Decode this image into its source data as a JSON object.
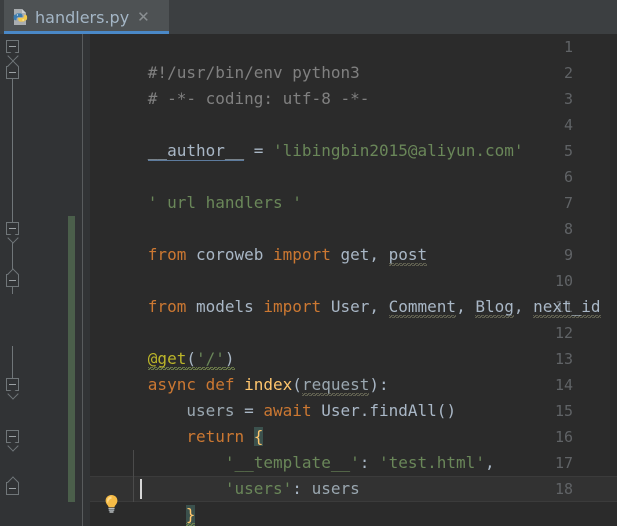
{
  "window": {
    "theme": "darcula",
    "background": "#2b2b2b"
  },
  "tabbar": {
    "tabs": [
      {
        "label": "handlers.py",
        "icon": "python-file-icon",
        "close_label": "✕",
        "active": true
      }
    ]
  },
  "editor": {
    "language": "Python",
    "caret": {
      "line": 18,
      "column": 10
    },
    "gutter": {
      "line_numbers": [
        "1",
        "2",
        "3",
        "4",
        "5",
        "6",
        "7",
        "8",
        "9",
        "10",
        "11",
        "12",
        "13",
        "14",
        "15",
        "16",
        "17",
        "18"
      ],
      "vcs_change_bar": {
        "from_line": 8,
        "to_line": 18,
        "color": "#4b5f4b"
      },
      "fold_markers": [
        {
          "line": 1,
          "type": "region-start"
        },
        {
          "line": 2,
          "type": "region-end"
        },
        {
          "line": 8,
          "type": "region-start"
        },
        {
          "line": 10,
          "type": "region-end"
        },
        {
          "line": 13,
          "type": "region-start"
        },
        {
          "line": 15,
          "type": "region-start"
        },
        {
          "line": 18,
          "type": "region-end"
        }
      ],
      "intention_bulb": {
        "line": 17,
        "icon": "lightbulb-icon"
      }
    },
    "lines": [
      {
        "n": 1,
        "text": "#!/usr/bin/env python3"
      },
      {
        "n": 2,
        "text": "# -*- coding: utf-8 -*-"
      },
      {
        "n": 3,
        "text": ""
      },
      {
        "n": 4,
        "text": "    __author__ = 'libingbin2015@aliyun.com'"
      },
      {
        "n": 5,
        "text": ""
      },
      {
        "n": 6,
        "text": "  ' url handlers '"
      },
      {
        "n": 7,
        "text": ""
      },
      {
        "n": 8,
        "text": "from coroweb import get, post"
      },
      {
        "n": 9,
        "text": ""
      },
      {
        "n": 10,
        "text": "from models import User, Comment, Blog, next_id"
      },
      {
        "n": 11,
        "text": ""
      },
      {
        "n": 12,
        "text": "  @get('/')"
      },
      {
        "n": 13,
        "text": "async def index(request):"
      },
      {
        "n": 14,
        "text": "    users = await User.findAll()"
      },
      {
        "n": 15,
        "text": "    return {"
      },
      {
        "n": 16,
        "text": "        '__template__': 'test.html',"
      },
      {
        "n": 17,
        "text": "        'users': users"
      },
      {
        "n": 18,
        "text": "    }"
      }
    ],
    "tokens": {
      "line1": {
        "comment": "#!/usr/bin/env python3"
      },
      "line2": {
        "comment": "# -*- coding: utf-8 -*-"
      },
      "line4": {
        "name": "__author__",
        "op": " = ",
        "string": "'libingbin2015@aliyun.com'"
      },
      "line6": {
        "string": "' url handlers '"
      },
      "line8": {
        "kw_from": "from",
        "module": " coroweb ",
        "kw_import": "import",
        "names": " get, ",
        "unused": "post"
      },
      "line10": {
        "kw_from": "from",
        "module": " models ",
        "kw_import": "import",
        "names": " User, ",
        "unused1": "Comment",
        "sep1": ", ",
        "unused2": "Blog",
        "sep2": ", ",
        "unused3": "next_id"
      },
      "line12": {
        "decorator": "@get",
        "paren_open": "(",
        "string": "'/'",
        "paren_close": ")"
      },
      "line13": {
        "kw_async": "async",
        "kw_def": " def",
        "fn": " index",
        "paren_open": "(",
        "param": "request",
        "paren_close": ")",
        "colon": ":"
      },
      "line14": {
        "var": "    users",
        "op": " = ",
        "kw_await": "await",
        "call": " User.findAll()"
      },
      "line15": {
        "kw_return": "    return ",
        "brace": "{"
      },
      "line16": {
        "key": "        '__template__'",
        "colon": ": ",
        "value": "'test.html'",
        "comma": ","
      },
      "line17": {
        "key": "        'users'",
        "colon": ": ",
        "value": "users"
      },
      "line18": {
        "brace": "}"
      }
    },
    "colors": {
      "background": "#2b2b2b",
      "gutter_background": "#313335",
      "line_number": "#606366",
      "default_text": "#a9b7c6",
      "keyword": "#cc7832",
      "string": "#6a8759",
      "comment": "#808080",
      "function": "#ffc66d",
      "decorator": "#bbb529",
      "variable": "#9aa7b0",
      "current_line": "#323232",
      "brace_match": "#3b514d",
      "vcs_modified": "#4b5f4b",
      "tab_active_underline": "#4a88c7",
      "tab_active_background": "#4e5254",
      "tab_label": "#a4b6c6"
    }
  }
}
